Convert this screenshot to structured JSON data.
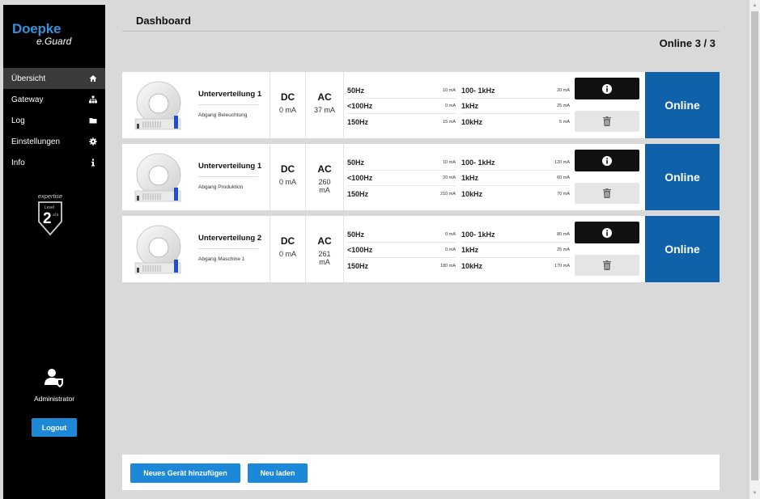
{
  "sidebar": {
    "brand": "Doepke",
    "product": "e.Guard",
    "items": [
      {
        "label": "Übersicht",
        "icon": "home-icon"
      },
      {
        "label": "Gateway",
        "icon": "network-icon"
      },
      {
        "label": "Log",
        "icon": "folder-icon"
      },
      {
        "label": "Einstellungen",
        "icon": "gear-icon"
      },
      {
        "label": "Info",
        "icon": "info-icon"
      }
    ],
    "badge": {
      "expertise": "expertise",
      "level_label": "Level",
      "level": "2",
      "of": "of 5"
    },
    "user": "Administrator",
    "logout_label": "Logout"
  },
  "header": {
    "title": "Dashboard",
    "online_count": "Online 3 / 3"
  },
  "devices": [
    {
      "name": "Unterverteilung 1",
      "sub": "Abgang Beleuchtung",
      "dc_label": "DC",
      "dc_value": "0 mA",
      "ac_label": "AC",
      "ac_value": "37 mA",
      "freq_left": [
        {
          "f": "50Hz",
          "v": "10 mA"
        },
        {
          "f": "<100Hz",
          "v": "0 mA"
        },
        {
          "f": "150Hz",
          "v": "15 mA"
        }
      ],
      "freq_right": [
        {
          "f": "100- 1kHz",
          "v": "20 mA"
        },
        {
          "f": "1kHz",
          "v": "25 mA"
        },
        {
          "f": "10kHz",
          "v": "5 mA"
        }
      ],
      "status": "Online"
    },
    {
      "name": "Unterverteilung 1",
      "sub": "Abgang Produktion",
      "dc_label": "DC",
      "dc_value": "0 mA",
      "ac_label": "AC",
      "ac_value": "260 mA",
      "freq_left": [
        {
          "f": "50Hz",
          "v": "10 mA"
        },
        {
          "f": "<100Hz",
          "v": "20 mA"
        },
        {
          "f": "150Hz",
          "v": "210 mA"
        }
      ],
      "freq_right": [
        {
          "f": "100- 1kHz",
          "v": "120 mA"
        },
        {
          "f": "1kHz",
          "v": "60 mA"
        },
        {
          "f": "10kHz",
          "v": "70 mA"
        }
      ],
      "status": "Online"
    },
    {
      "name": "Unterverteilung 2",
      "sub": "Abgang Maschine 1",
      "dc_label": "DC",
      "dc_value": "0 mA",
      "ac_label": "AC",
      "ac_value": "261 mA",
      "freq_left": [
        {
          "f": "50Hz",
          "v": "0 mA"
        },
        {
          "f": "<100Hz",
          "v": "0 mA"
        },
        {
          "f": "150Hz",
          "v": "180 mA"
        }
      ],
      "freq_right": [
        {
          "f": "100- 1kHz",
          "v": "80 mA"
        },
        {
          "f": "1kHz",
          "v": "25 mA"
        },
        {
          "f": "10kHz",
          "v": "170 mA"
        }
      ],
      "status": "Online"
    }
  ],
  "footer": {
    "add_label": "Neues Gerät hinzufügen",
    "reload_label": "Neu laden"
  },
  "colors": {
    "accent": "#1e88d8",
    "online": "#0f62aa",
    "sidebar": "#000000"
  }
}
